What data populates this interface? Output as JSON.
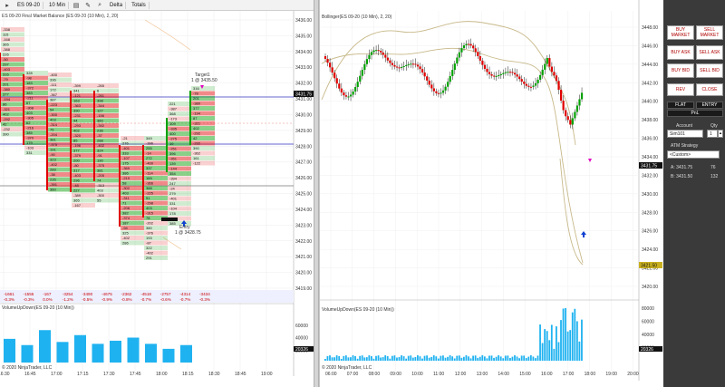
{
  "left_chart": {
    "toolbar": {
      "instrument": "ES 09-20",
      "interval": "10 Min",
      "style": "Delta",
      "totals": "Totals"
    },
    "indicator_label": "ES 09-20 Final Market Balance (ES 09-20 (10 Min), 2, 20)",
    "volume_label": "VolumeUpDown(ES 09-20 (10 Min))",
    "copyright": "© 2020 NinjaTrader, LLC",
    "target_label": "Target1",
    "target_price_label": "1 @ 3435.50",
    "entry_label": "Entry",
    "entry_price_label": "1 @ 3428.75",
    "current_price_tag": "3431.75",
    "volume_tag": "20326",
    "price_axis": [
      "3436.00",
      "3435.00",
      "3434.00",
      "3433.00",
      "3432.00",
      "3431.00",
      "3430.00",
      "3429.00",
      "3428.00",
      "3427.00",
      "3426.00",
      "3425.00",
      "3424.00",
      "3423.00",
      "3422.00",
      "3421.00",
      "3420.00",
      "3419.00"
    ],
    "time_axis": [
      "16:30",
      "16:45",
      "17:00",
      "17:15",
      "17:30",
      "17:45",
      "18:00",
      "18:15",
      "18:30",
      "18:45",
      "19:00"
    ],
    "volume_axis": [
      "60000",
      "40000",
      "20000"
    ],
    "deltas_row1": [
      "-1661",
      "-1555",
      "-167",
      "-3254",
      "-3490",
      "-4675",
      "-2362",
      "-4518",
      "-2757",
      "-4314",
      "-3434"
    ],
    "deltas_row2": [
      "-0.3%",
      "-0.3%",
      "0.0%",
      "-1.2%",
      "-0.5%",
      "-0.9%",
      "-0.8%",
      "-0.7%",
      "-0.6%",
      "-0.7%",
      "-0.3%"
    ],
    "chart_data": {
      "type": "bar",
      "title": "",
      "categories": [
        "16:30",
        "16:40",
        "16:50",
        "17:00",
        "17:10",
        "17:20",
        "17:30",
        "17:40",
        "17:50",
        "18:00",
        "18:10"
      ],
      "values": [
        38000,
        28000,
        52000,
        33000,
        44000,
        30000,
        35000,
        40000,
        30000,
        22000,
        28000
      ],
      "ylim": [
        0,
        80000
      ]
    }
  },
  "right_chart": {
    "indicator_label": "Bollinger(ES 09-20 (10 Min), 2, 20)",
    "volume_label": "VolumeUpDown(ES 09-20 (10 Min))",
    "copyright": "© 2020 NinjaTrader, LLC",
    "price_tag_current": "3431.75",
    "price_tag_low": "3421.50",
    "volume_tag": "20326",
    "price_axis": [
      "3448.00",
      "3446.00",
      "3444.00",
      "3442.00",
      "3440.00",
      "3438.00",
      "3436.00",
      "3434.00",
      "3432.00",
      "3430.00",
      "3428.00",
      "3426.00",
      "3424.00",
      "3422.00",
      "3420.00"
    ],
    "time_axis": [
      "06:00",
      "07:00",
      "08:00",
      "09:00",
      "10:00",
      "11:00",
      "12:00",
      "13:00",
      "14:00",
      "15:00",
      "16:00",
      "17:00",
      "18:00",
      "19:00",
      "20:00"
    ],
    "volume_axis": [
      "80000",
      "60000",
      "40000",
      "20000"
    ]
  },
  "order_panel": {
    "buy_market": "BUY MARKET",
    "sell_market": "SELL MARKET",
    "buy_ask": "BUY ASK",
    "sell_ask": "SELL ASK",
    "buy_bid": "BUY BID",
    "sell_bid": "SELL BID",
    "rev": "REV",
    "close": "CLOSE",
    "flat": "FLAT",
    "entry": "ENTRY",
    "pnl": "PnL",
    "account_label": "Account",
    "qty_label": "Qty",
    "account_value": "Sim101",
    "qty_value": "1",
    "atm_label": "ATM Strategy",
    "atm_value": "<Custom>",
    "ask_label": "A: 3431.75",
    "ask_size": "76",
    "bid_label": "B: 3431.50",
    "bid_size": "132"
  },
  "colors": {
    "up": "#00a000",
    "down": "#e00000",
    "volume": "#1fb2f0",
    "bollinger": "#c8b98a",
    "level_line": "#3030c0"
  }
}
